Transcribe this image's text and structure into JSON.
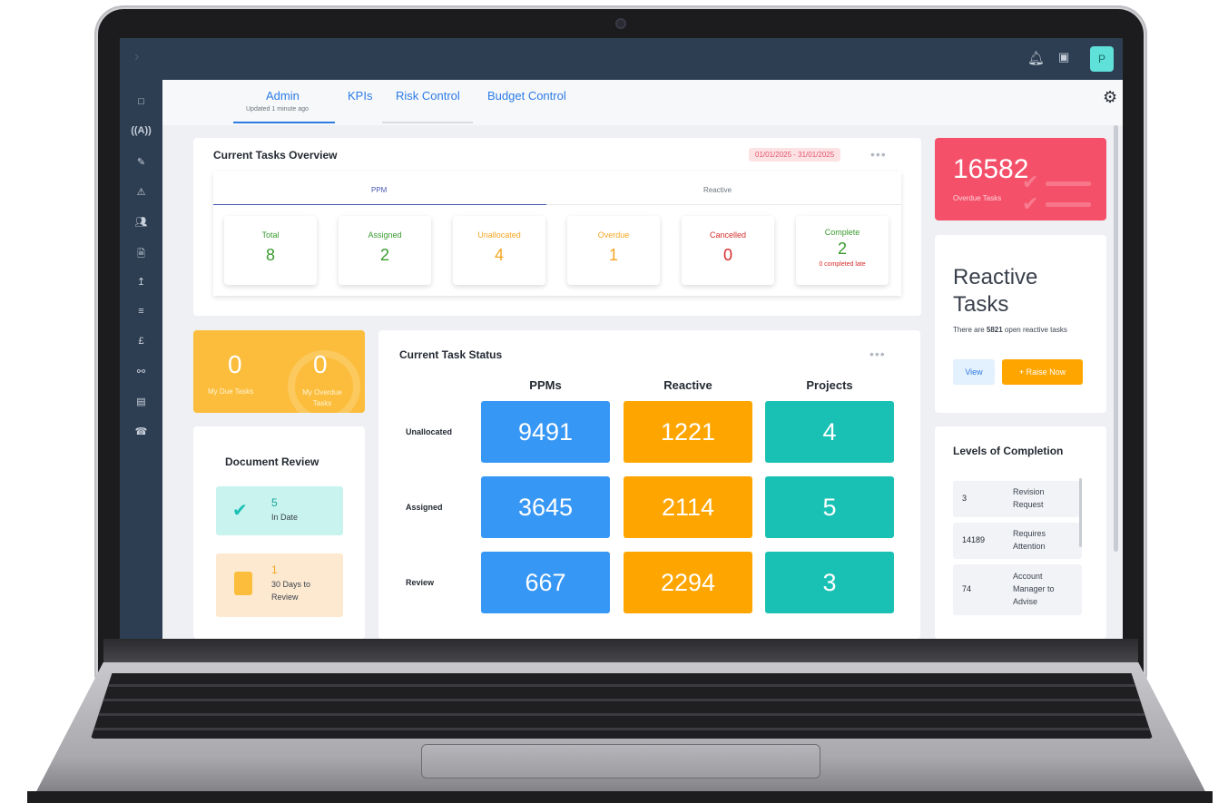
{
  "topbar": {
    "user_initial": "P"
  },
  "tabs": [
    {
      "label": "Admin",
      "sub": "Updated 1 minute ago"
    },
    {
      "label": "KPIs"
    },
    {
      "label": "Risk Control"
    },
    {
      "label": "Budget Control"
    }
  ],
  "current_tasks": {
    "title": "Current Tasks Overview",
    "date_range": "01/01/2025 - 31/01/2025",
    "tabs": [
      "PPM",
      "Reactive"
    ],
    "stats": [
      {
        "label": "Total",
        "value": "8",
        "color": "#3a9a2f"
      },
      {
        "label": "Assigned",
        "value": "2",
        "color": "#3a9a2f"
      },
      {
        "label": "Unallocated",
        "value": "4",
        "color": "#f5a623"
      },
      {
        "label": "Overdue",
        "value": "1",
        "color": "#f5a623"
      },
      {
        "label": "Cancelled",
        "value": "0",
        "color": "#d62c2c"
      },
      {
        "label": "Complete",
        "value": "2",
        "color": "#3a9a2f",
        "note": "0 completed late"
      }
    ]
  },
  "due_tasks": {
    "my_due_value": "0",
    "my_due_label": "My Due Tasks",
    "my_overdue_value": "0",
    "my_overdue_label": "My Overdue Tasks"
  },
  "document_review": {
    "title": "Document Review",
    "items": [
      {
        "value": "5",
        "label": "In Date"
      },
      {
        "value": "1",
        "label": "30 Days to Review"
      }
    ]
  },
  "task_status": {
    "title": "Current Task Status",
    "columns": [
      "PPMs",
      "Reactive",
      "Projects"
    ],
    "rows": [
      {
        "label": "Unallocated",
        "values": [
          "9491",
          "1221",
          "4"
        ]
      },
      {
        "label": "Assigned",
        "values": [
          "3645",
          "2114",
          "5"
        ]
      },
      {
        "label": "Review",
        "values": [
          "667",
          "2294",
          "3"
        ]
      }
    ],
    "colors": [
      "#3797f5",
      "#ffa500",
      "#19c1b4"
    ]
  },
  "overdue": {
    "value": "16582",
    "label": "Overdue Tasks"
  },
  "reactive_tasks": {
    "title_line1": "Reactive",
    "title_line2": "Tasks",
    "desc_prefix": "There are ",
    "desc_count": "5821",
    "desc_suffix": " open reactive tasks",
    "view_label": "View",
    "raise_label": "+  Raise Now"
  },
  "levels": {
    "title": "Levels of Completion",
    "rows": [
      {
        "value": "3",
        "label": "Revision Request"
      },
      {
        "value": "14189",
        "label": "Requires Attention"
      },
      {
        "value": "74",
        "label": "Account Manager to Advise"
      }
    ]
  }
}
